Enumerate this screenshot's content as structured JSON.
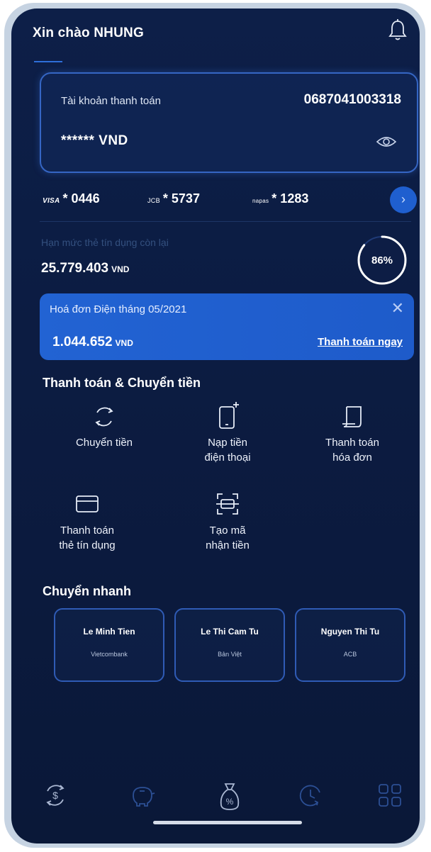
{
  "header": {
    "greeting": "Xin chào NHUNG"
  },
  "account": {
    "label": "Tài khoản thanh toán",
    "number": "0687041003318",
    "balance": "****** VND"
  },
  "cards": [
    {
      "brand": "VISA",
      "number": "* 0446"
    },
    {
      "brand": "JCB",
      "number": "* 5737"
    },
    {
      "brand": "napas",
      "number": "* 1283"
    }
  ],
  "credit": {
    "label": "Hạn mức thẻ tín dụng còn lại",
    "amount": "25.779.403",
    "unit": "VND",
    "percent_label": "86%",
    "percent_value": 0.86
  },
  "bill": {
    "title": "Hoá đơn Điện tháng 05/2021",
    "amount": "1.044.652",
    "unit": "VND",
    "pay_label": "Thanh toán ngay"
  },
  "services": {
    "title": "Thanh toán & Chuyển tiền",
    "items": [
      {
        "line1": "Chuyển tiền",
        "line2": "",
        "icon": "transfer-icon"
      },
      {
        "line1": "Nạp tiền",
        "line2": "điện thoại",
        "icon": "phone-topup-icon"
      },
      {
        "line1": "Thanh toán",
        "line2": "hóa đơn",
        "icon": "bill-icon"
      },
      {
        "line1": "Thanh toán",
        "line2": "thẻ tín dụng",
        "icon": "credit-card-icon"
      },
      {
        "line1": "Tạo mã",
        "line2": "nhận tiền",
        "icon": "qr-scan-icon"
      }
    ]
  },
  "quick_transfer": {
    "title": "Chuyển nhanh",
    "items": [
      {
        "name": "Le Minh Tien",
        "bank": "Vietcombank"
      },
      {
        "name": "Le Thi Cam Tu",
        "bank": "Bản Việt"
      },
      {
        "name": "Nguyen Thi Tu",
        "bank": "ACB"
      }
    ]
  },
  "tabbar": [
    "money-exchange-icon",
    "piggy-bank-icon",
    "money-bag-percent-icon",
    "clock-history-icon",
    "grid-menu-icon"
  ],
  "colors": {
    "background": "#0c1c42",
    "accent": "#2263d3",
    "card_border": "#3566c4"
  }
}
